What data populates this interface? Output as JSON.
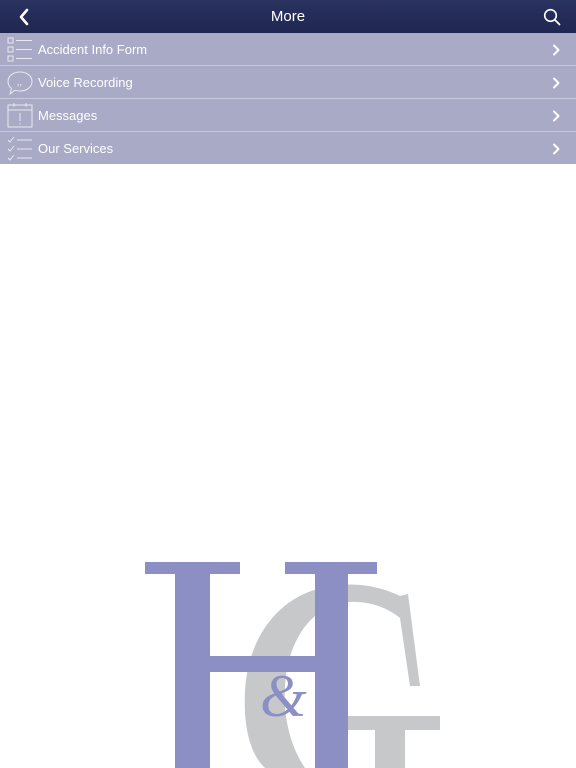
{
  "header": {
    "title": "More",
    "back_icon": "chevron-left-icon",
    "search_icon": "search-icon"
  },
  "menu": {
    "items": [
      {
        "label": "Accident Info Form",
        "icon": "form-list-icon"
      },
      {
        "label": "Voice Recording",
        "icon": "speech-bubble-icon"
      },
      {
        "label": "Messages",
        "icon": "calendar-alert-icon"
      },
      {
        "label": "Our Services",
        "icon": "checklist-icon"
      }
    ]
  },
  "logo": {
    "letters": "H&G",
    "primary_color": "#8b8fc4",
    "secondary_color": "#c7c8ca"
  },
  "colors": {
    "navbar": "#232a56",
    "menu_background": "#a8aac6",
    "menu_text": "#ffffff"
  }
}
